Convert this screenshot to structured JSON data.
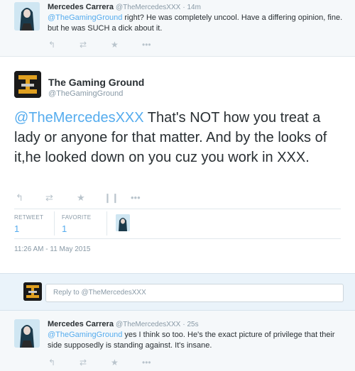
{
  "tweets": {
    "top": {
      "name": "Mercedes Carrera",
      "handle": "@TheMercedesXXX",
      "time": "· 14m",
      "mention": "@TheGamingGround",
      "text": " right? He was completely uncool. Have a differing opinion, fine. but he was SUCH a dick about it."
    },
    "main": {
      "name": "The Gaming Ground",
      "handle": "@TheGamingGround",
      "mention": "@TheMercedesXXX",
      "text": " That's NOT how you treat a lady or anyone for that matter. And by the looks of it,he looked down on you cuz you work in XXX.",
      "stats": {
        "retweet_label": "RETWEET",
        "retweet_count": "1",
        "favorite_label": "FAVORITE",
        "favorite_count": "1"
      },
      "date": "11:26 AM - 11 May 2015"
    },
    "bottom": {
      "name": "Mercedes Carrera",
      "handle": "@TheMercedesXXX",
      "time": "· 25s",
      "mention": "@TheGamingGround",
      "text": " yes I think so too. He's the exact picture of privilege that their side supposedly is standing against. It's insane."
    }
  },
  "reply": {
    "placeholder": "Reply to @TheMercedesXXX"
  },
  "icons": {
    "reply": "reply-icon",
    "retweet": "retweet-icon",
    "favorite": "star-icon",
    "stats": "bar-chart-icon",
    "more": "more-icon"
  },
  "colors": {
    "link": "#55acee",
    "muted": "#8899a6",
    "icon": "#b9c4cc",
    "reply_bar_bg": "#eaf3fa",
    "small_tweet_bg": "#f5f8fa"
  }
}
